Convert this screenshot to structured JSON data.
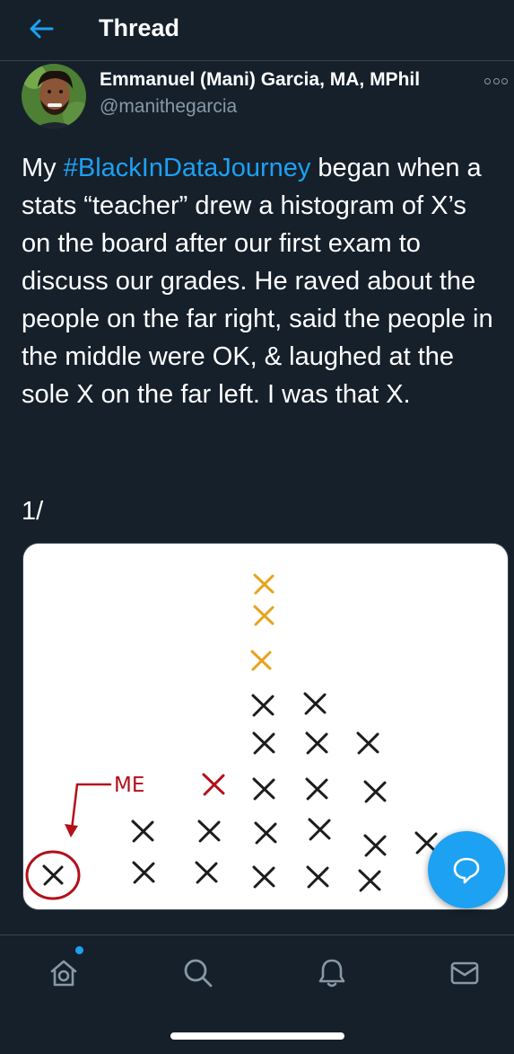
{
  "header": {
    "title": "Thread",
    "back_icon": "arrow-left-icon"
  },
  "tweet": {
    "display_name": "Emmanuel (Mani) Garcia, MA, MPhil",
    "handle": "@manithegarcia",
    "more_icon": "more-options-icon",
    "text_prefix": "My ",
    "hashtag": "#BlackInDataJourney",
    "text_rest": " began when a stats “teacher” drew a histogram of X’s on the board after our first exam to discuss our grades. He raved about the people on the far right, said the people in the middle were OK, & laughed at the sole X on the far left. I was that X.",
    "thread_number": "1/"
  },
  "media": {
    "annotation": "ME"
  },
  "nav": {
    "tabs": [
      "home",
      "search",
      "notifications",
      "messages"
    ]
  },
  "colors": {
    "background": "#15202b",
    "accent": "#1da1f2",
    "secondary_text": "#8899a6",
    "x_red": "#b3101a",
    "x_orange": "#e8a21b"
  }
}
